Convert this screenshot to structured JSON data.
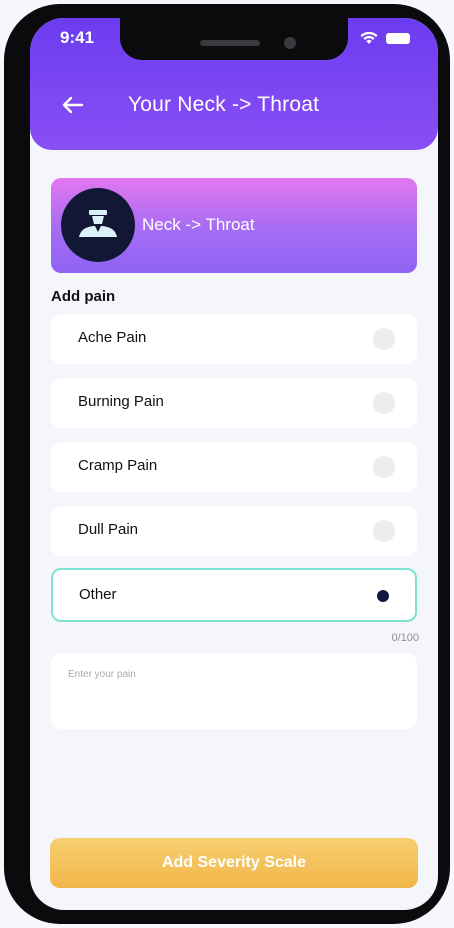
{
  "status_bar": {
    "time": "9:41",
    "icons": [
      "wifi-icon",
      "battery-icon"
    ]
  },
  "header": {
    "back_icon": "back-arrow-icon",
    "title": "Your Neck -> Throat"
  },
  "hero": {
    "avatar_icon": "person-neck-icon",
    "label": "Neck -> Throat"
  },
  "section": {
    "label": "Add pain"
  },
  "options": [
    {
      "label": "Ache Pain",
      "selected": false
    },
    {
      "label": "Burning Pain",
      "selected": false
    },
    {
      "label": "Cramp Pain",
      "selected": false
    },
    {
      "label": "Dull Pain",
      "selected": false
    },
    {
      "label": "Other",
      "selected": true
    }
  ],
  "input": {
    "counter": "0/100",
    "placeholder": "Enter your pain"
  },
  "cta": {
    "label": "Add Severity Scale"
  },
  "colors": {
    "header_purple": "#6b3cf0",
    "hero_pink": "#e277f0",
    "selected_border": "#7fe3d2",
    "cta_yellow": "#f2b64a",
    "avatar_navy": "#111735"
  }
}
